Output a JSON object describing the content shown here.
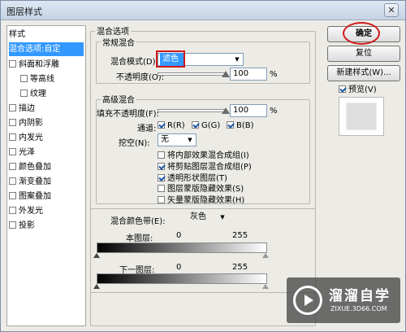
{
  "window": {
    "title": "图层样式",
    "close_glyph": "✕"
  },
  "styles_panel": {
    "header": "样式",
    "items": [
      {
        "label": "混合选项:自定",
        "selected": true,
        "checkbox": false,
        "indent": false
      },
      {
        "label": "斜面和浮雕",
        "checked": false,
        "checkbox": true,
        "indent": false
      },
      {
        "label": "等高线",
        "checked": false,
        "checkbox": true,
        "indent": true
      },
      {
        "label": "纹理",
        "checked": false,
        "checkbox": true,
        "indent": true
      },
      {
        "label": "描边",
        "checked": false,
        "checkbox": true,
        "indent": false
      },
      {
        "label": "内阴影",
        "checked": false,
        "checkbox": true,
        "indent": false
      },
      {
        "label": "内发光",
        "checked": false,
        "checkbox": true,
        "indent": false
      },
      {
        "label": "光泽",
        "checked": false,
        "checkbox": true,
        "indent": false
      },
      {
        "label": "颜色叠加",
        "checked": false,
        "checkbox": true,
        "indent": false
      },
      {
        "label": "渐变叠加",
        "checked": false,
        "checkbox": true,
        "indent": false
      },
      {
        "label": "图案叠加",
        "checked": false,
        "checkbox": true,
        "indent": false
      },
      {
        "label": "外发光",
        "checked": false,
        "checkbox": true,
        "indent": false
      },
      {
        "label": "投影",
        "checked": false,
        "checkbox": true,
        "indent": false
      }
    ]
  },
  "blend_options": {
    "title": "混合选项",
    "general": {
      "title": "常规混合",
      "blend_mode_label": "混合模式(D):",
      "blend_mode_value": "滤色",
      "opacity_label": "不透明度(O):",
      "opacity_value": "100",
      "opacity_unit": "%"
    },
    "advanced": {
      "title": "高级混合",
      "fill_opacity_label": "填充不透明度(F):",
      "fill_opacity_value": "100",
      "fill_unit": "%",
      "channels_label": "通道:",
      "channels": [
        {
          "label": "R(R)",
          "checked": true
        },
        {
          "label": "G(G)",
          "checked": true
        },
        {
          "label": "B(B)",
          "checked": true
        }
      ],
      "knockout_label": "挖空(N):",
      "knockout_value": "无",
      "options": [
        {
          "label": "将内部效果混合成组(I)",
          "checked": false
        },
        {
          "label": "将剪贴图层混合成组(P)",
          "checked": true
        },
        {
          "label": "透明形状图层(T)",
          "checked": true
        },
        {
          "label": "图层蒙版隐藏效果(S)",
          "checked": false
        },
        {
          "label": "矢量蒙版隐藏效果(H)",
          "checked": false
        }
      ]
    },
    "blend_if": {
      "label": "混合颜色带(E):",
      "value": "灰色",
      "this_layer_label": "本图层:",
      "this_layer_min": "0",
      "this_layer_max": "255",
      "underlying_label": "下一图层:",
      "underlying_min": "0",
      "underlying_max": "255"
    }
  },
  "buttons": {
    "ok": "确定",
    "reset": "复位",
    "new_style": "新建样式(W)...",
    "preview": "预览(V)"
  },
  "watermark": {
    "name": "溜溜自学",
    "url": "ZIXUE.3D66.COM"
  },
  "colors": {
    "selection": "#3399ff",
    "highlight_ring": "#d01818"
  }
}
